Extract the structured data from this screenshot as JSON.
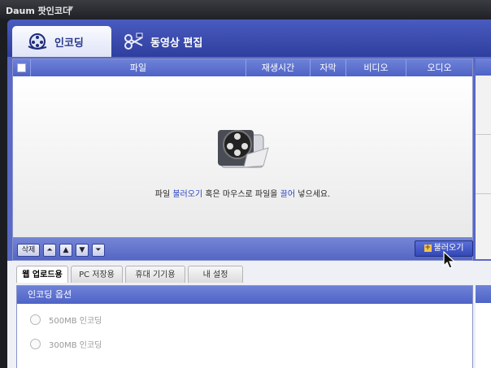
{
  "window": {
    "title": "Daum 팟인코더",
    "title_dropdown_icon": "caret-down-icon"
  },
  "main_tabs": [
    {
      "label": "인코딩",
      "icon": "film-reel-icon",
      "active": true
    },
    {
      "label": "동영상 편집",
      "icon": "scissors-film-icon",
      "active": false
    }
  ],
  "file_table": {
    "columns": [
      "파일",
      "재생시간",
      "자막",
      "비디오",
      "오디오"
    ],
    "empty_message": {
      "part1": "파일 ",
      "link1": "불러오기",
      "part2": " 혹은 마우스로 파일을 ",
      "link2": "끌어",
      "part3": " 넣으세요."
    }
  },
  "file_toolbar": {
    "delete_label": "삭제",
    "move_top_icon": "move-top-icon",
    "move_up_icon": "move-up-icon",
    "move_down_icon": "move-down-icon",
    "move_bottom_icon": "move-bottom-icon",
    "load_label": "불러오기"
  },
  "preset_tabs": [
    {
      "label": "웹 업로드용",
      "active": true
    },
    {
      "label": "PC 저장용",
      "active": false
    },
    {
      "label": "휴대 기기용",
      "active": false
    },
    {
      "label": "내 설정",
      "active": false
    }
  ],
  "encoding_options": {
    "title": "인코딩 옵션",
    "options": [
      "500MB 인코딩",
      "300MB 인코딩"
    ]
  },
  "colors": {
    "accent": "#4e63c6",
    "highlight_text": "#2a45c0"
  }
}
